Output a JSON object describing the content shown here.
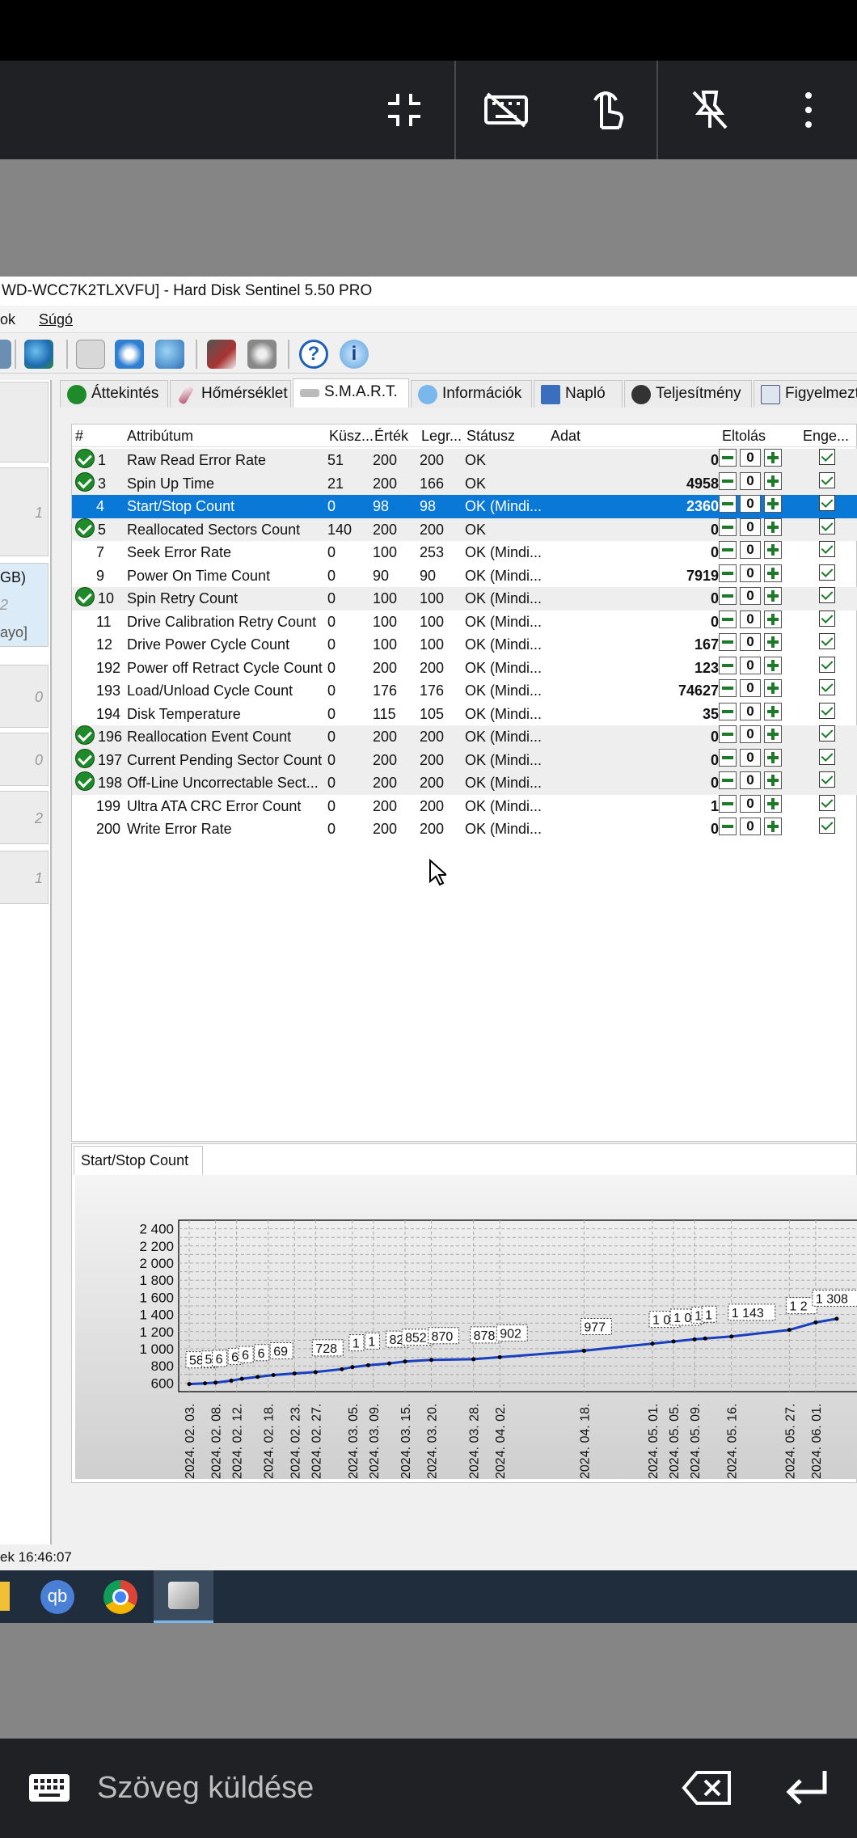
{
  "window": {
    "title": "WD-WCC7K2TLXVFU]  -  Hard Disk Sentinel 5.50 PRO",
    "menu": [
      "ok",
      "Súgó"
    ],
    "status_time": "ek 16:46:07"
  },
  "remote_toolbar": {
    "icons": [
      "exit-fullscreen-icon",
      "keyboard-off-icon",
      "touch-icon",
      "unpin-icon",
      "more-options-icon"
    ]
  },
  "left_panel": [
    "1",
    "GB)",
    "2",
    "ayo]",
    "0",
    "0",
    "2",
    "1"
  ],
  "tabs": [
    "Áttekintés",
    "Hőmérséklet",
    "S.M.A.R.T.",
    "Információk",
    "Napló",
    "Teljesítmény",
    "Figyelmezt"
  ],
  "grid": {
    "headers": [
      "#",
      "Attribútum",
      "Küsz...",
      "Érték",
      "Legr...",
      "Státusz",
      "Adat",
      "Eltolás",
      "Enge..."
    ],
    "rows": [
      {
        "icon": true,
        "id": "1",
        "name": "Raw Read Error Rate",
        "thr": "51",
        "val": "200",
        "worst": "200",
        "status": "OK",
        "data": "0",
        "off": "0"
      },
      {
        "icon": true,
        "id": "3",
        "name": "Spin Up Time",
        "thr": "21",
        "val": "200",
        "worst": "166",
        "status": "OK",
        "data": "4958",
        "off": "0"
      },
      {
        "icon": false,
        "id": "4",
        "name": "Start/Stop Count",
        "thr": "0",
        "val": "98",
        "worst": "98",
        "status": "OK (Mindi...",
        "data": "2360",
        "off": "0"
      },
      {
        "icon": true,
        "id": "5",
        "name": "Reallocated Sectors Count",
        "thr": "140",
        "val": "200",
        "worst": "200",
        "status": "OK",
        "data": "0",
        "off": "0"
      },
      {
        "icon": false,
        "id": "7",
        "name": "Seek Error Rate",
        "thr": "0",
        "val": "100",
        "worst": "253",
        "status": "OK (Mindi...",
        "data": "0",
        "off": "0"
      },
      {
        "icon": false,
        "id": "9",
        "name": "Power On Time Count",
        "thr": "0",
        "val": "90",
        "worst": "90",
        "status": "OK (Mindi...",
        "data": "7919",
        "off": "0"
      },
      {
        "icon": true,
        "id": "10",
        "name": "Spin Retry Count",
        "thr": "0",
        "val": "100",
        "worst": "100",
        "status": "OK (Mindi...",
        "data": "0",
        "off": "0"
      },
      {
        "icon": false,
        "id": "11",
        "name": "Drive Calibration Retry Count",
        "thr": "0",
        "val": "100",
        "worst": "100",
        "status": "OK (Mindi...",
        "data": "0",
        "off": "0"
      },
      {
        "icon": false,
        "id": "12",
        "name": "Drive Power Cycle Count",
        "thr": "0",
        "val": "100",
        "worst": "100",
        "status": "OK (Mindi...",
        "data": "167",
        "off": "0"
      },
      {
        "icon": false,
        "id": "192",
        "name": "Power off Retract Cycle Count",
        "thr": "0",
        "val": "200",
        "worst": "200",
        "status": "OK (Mindi...",
        "data": "123",
        "off": "0"
      },
      {
        "icon": false,
        "id": "193",
        "name": "Load/Unload Cycle Count",
        "thr": "0",
        "val": "176",
        "worst": "176",
        "status": "OK (Mindi...",
        "data": "74627",
        "off": "0"
      },
      {
        "icon": false,
        "id": "194",
        "name": "Disk Temperature",
        "thr": "0",
        "val": "115",
        "worst": "105",
        "status": "OK (Mindi...",
        "data": "35",
        "off": "0"
      },
      {
        "icon": true,
        "id": "196",
        "name": "Reallocation Event Count",
        "thr": "0",
        "val": "200",
        "worst": "200",
        "status": "OK (Mindi...",
        "data": "0",
        "off": "0"
      },
      {
        "icon": true,
        "id": "197",
        "name": "Current Pending Sector Count",
        "thr": "0",
        "val": "200",
        "worst": "200",
        "status": "OK (Mindi...",
        "data": "0",
        "off": "0"
      },
      {
        "icon": true,
        "id": "198",
        "name": "Off-Line Uncorrectable Sect...",
        "thr": "0",
        "val": "200",
        "worst": "200",
        "status": "OK (Mindi...",
        "data": "0",
        "off": "0"
      },
      {
        "icon": false,
        "id": "199",
        "name": "Ultra ATA CRC Error Count",
        "thr": "0",
        "val": "200",
        "worst": "200",
        "status": "OK (Mindi...",
        "data": "1",
        "off": "0"
      },
      {
        "icon": false,
        "id": "200",
        "name": "Write Error Rate",
        "thr": "0",
        "val": "200",
        "worst": "200",
        "status": "OK (Mindi...",
        "data": "0",
        "off": "0"
      }
    ]
  },
  "chart_tab": "Start/Stop Count",
  "chart_data": {
    "type": "line",
    "title": "",
    "xlabel": "",
    "ylabel": "",
    "ylim": [
      500,
      2500
    ],
    "yticks": [
      "2 400",
      "2 200",
      "2 000",
      "1 800",
      "1 600",
      "1 400",
      "1 200",
      "1 000",
      "800",
      "600"
    ],
    "xticks": [
      "2024. 02. 03.",
      "2024. 02. 08.",
      "2024. 02. 12.",
      "2024. 02. 18.",
      "2024. 02. 23.",
      "2024. 02. 27.",
      "2024. 03. 05.",
      "2024. 03. 09.",
      "2024. 03. 15.",
      "2024. 03. 20.",
      "2024. 03. 28.",
      "2024. 04. 02.",
      "2024. 04. 18.",
      "2024. 05. 01.",
      "2024. 05. 05.",
      "2024. 05. 09.",
      "2024. 05. 16.",
      "2024. 05. 27.",
      "2024. 06. 01."
    ],
    "x": [
      "2024-02-03",
      "2024-02-06",
      "2024-02-08",
      "2024-02-11",
      "2024-02-13",
      "2024-02-16",
      "2024-02-19",
      "2024-02-23",
      "2024-02-27",
      "2024-03-03",
      "2024-03-05",
      "2024-03-08",
      "2024-03-12",
      "2024-03-15",
      "2024-03-20",
      "2024-03-28",
      "2024-04-02",
      "2024-04-18",
      "2024-05-01",
      "2024-05-05",
      "2024-05-09",
      "2024-05-11",
      "2024-05-16",
      "2024-05-27",
      "2024-06-01",
      "2024-06-05"
    ],
    "values": [
      589,
      597,
      605,
      628,
      650,
      672,
      693,
      712,
      728,
      762,
      786,
      808,
      829,
      852,
      870,
      878,
      902,
      977,
      1060,
      1085,
      1110,
      1120,
      1143,
      1220,
      1308,
      1350
    ],
    "labels": [
      "589",
      "5",
      "6",
      "6",
      "6",
      "6",
      "69",
      "",
      "728",
      "",
      "1",
      "1",
      "82",
      "852",
      "870",
      "878",
      "902",
      "977",
      "1 0",
      "1 0",
      "1",
      "1",
      "1 143",
      "1 2",
      "1 308",
      ""
    ]
  },
  "bottom": {
    "placeholder": "Szöveg küldése"
  }
}
